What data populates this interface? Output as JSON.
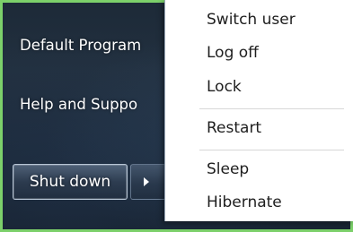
{
  "start_menu": {
    "items": [
      {
        "label": "Default Program"
      },
      {
        "label": "Help and Suppo"
      }
    ],
    "shutdown_label": "Shut down"
  },
  "power_menu": {
    "items": [
      {
        "label": "Switch user"
      },
      {
        "label": "Log off"
      },
      {
        "label": "Lock"
      },
      {
        "label": "Restart"
      },
      {
        "label": "Sleep"
      },
      {
        "label": "Hibernate"
      }
    ]
  },
  "icons": {
    "submenu_arrow": "arrow-right-icon"
  },
  "colors": {
    "background_green": "#7cd06a",
    "start_menu_dark": "#1d2a38",
    "menu_background": "#ffffff",
    "menu_text": "#1e1e1e"
  }
}
